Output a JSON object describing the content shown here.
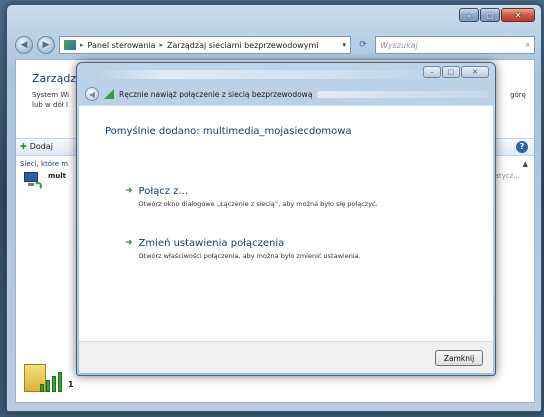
{
  "window": {
    "breadcrumb": [
      "Panel sterowania",
      "Zarządzaj sieciami bezprzewodowymi"
    ],
    "search_placeholder": "Wyszukaj",
    "page_title_partial": "Zarządz",
    "desc_line1": "System Wi",
    "desc_line2": "lub w dół l",
    "desc_right": "górę",
    "toolbar_add": "Dodaj",
    "list_header": "Sieci, które m",
    "network_partial": "mult",
    "right_trail": "natycz...",
    "bottom_mark": "1"
  },
  "dialog": {
    "header_title": "Ręcznie nawiąż połączenie z siecią bezprzewodową",
    "status": "Pomyślnie dodano: multimedia_mojasiecdomowa",
    "options": [
      {
        "title": "Połącz z...",
        "description": "Otwórz okno dialogowe „Łączenie z siecią”, aby można było się połączyć."
      },
      {
        "title": "Zmień ustawienia połączenia",
        "description": "Otwórz właściwości połączenia, aby można było zmienić ustawienia."
      }
    ],
    "close_label": "Zamknij"
  },
  "colors": {
    "link_blue": "#1a3b6a",
    "arrow_green": "#2e8b2e"
  }
}
